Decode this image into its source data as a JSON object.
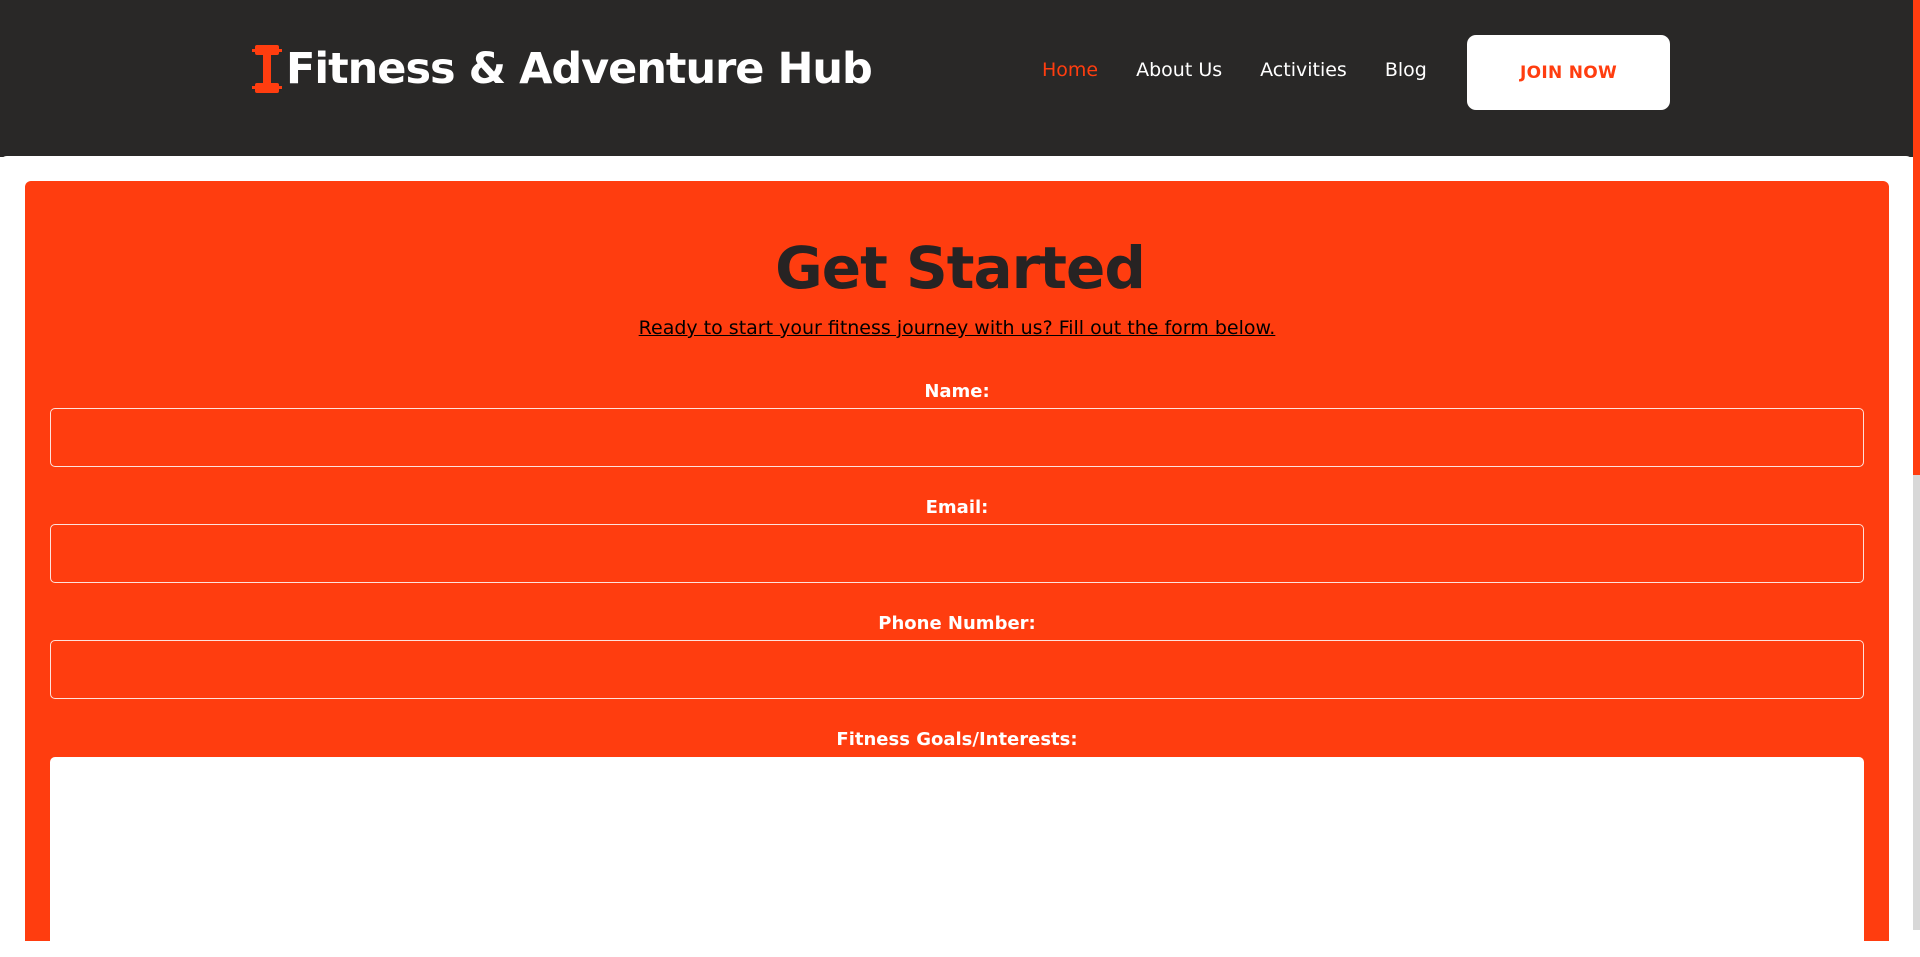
{
  "header": {
    "brand_name": "Fitness & Adventure Hub",
    "brand_icon": "dumbbell-icon",
    "nav": {
      "home": "Home",
      "about": "About Us",
      "activities": "Activities",
      "blog": "Blog"
    },
    "active_nav": "Home",
    "join_label": "JOIN NOW"
  },
  "form": {
    "title": "Get Started",
    "subtitle": "Ready to start your fitness journey with us? Fill out the form below.",
    "name_label": "Name:",
    "name_value": "",
    "email_label": "Email:",
    "email_value": "",
    "phone_label": "Phone Number:",
    "phone_value": "",
    "goals_label": "Fitness Goals/Interests:",
    "goals_value": ""
  },
  "colors": {
    "header_bg": "#292827",
    "accent": "#ff3d0f",
    "heading_text": "#272323",
    "white": "#ffffff"
  }
}
